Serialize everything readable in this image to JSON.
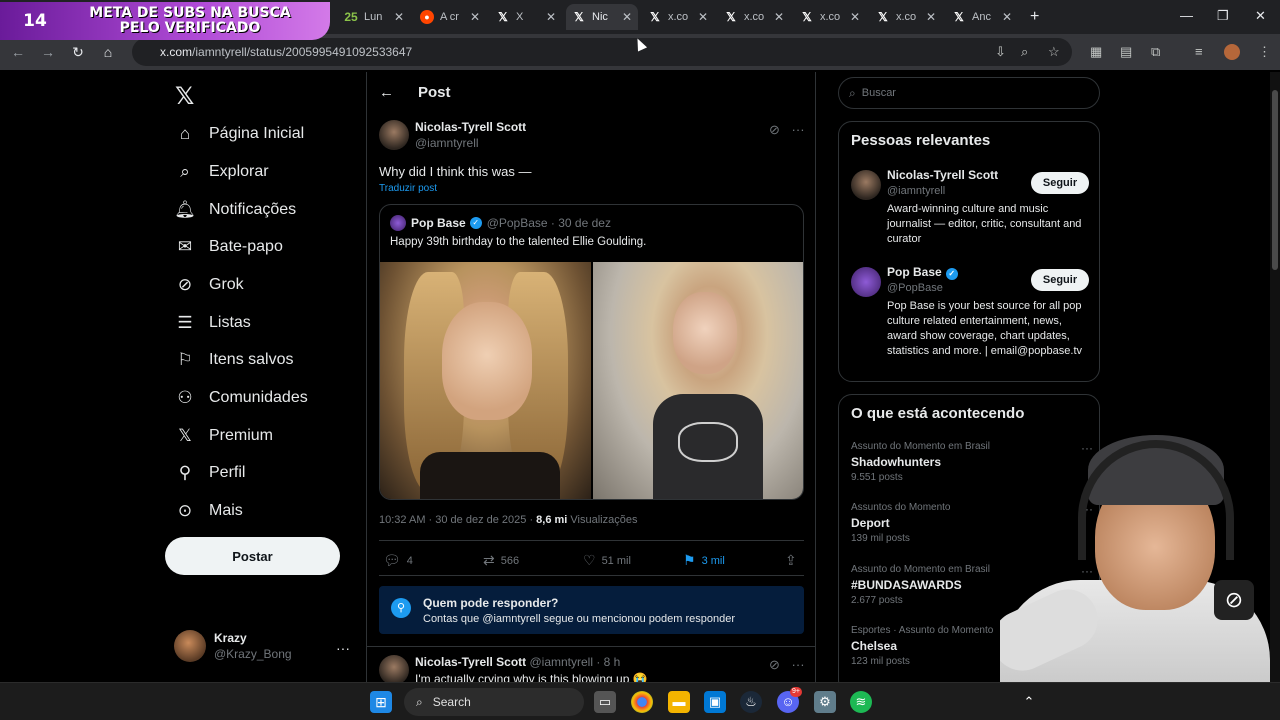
{
  "overlay": {
    "number": "14",
    "text": "META DE SUBS NA BUSCA PELO VERIFICADO",
    "number2": "25"
  },
  "tabs": [
    {
      "icon": "X",
      "label": "Lun"
    },
    {
      "icon": "R",
      "label": "A cr"
    },
    {
      "icon": "X",
      "label": "X"
    },
    {
      "icon": "X",
      "label": "Nic"
    },
    {
      "icon": "X",
      "label": "x.co"
    },
    {
      "icon": "X",
      "label": "x.co"
    },
    {
      "icon": "X",
      "label": "x.co"
    },
    {
      "icon": "X",
      "label": "x.co"
    },
    {
      "icon": "X",
      "label": "Anc"
    }
  ],
  "browser": {
    "url_host": "x.com",
    "url_path": "/iamntyrell/status/2005995491092533647"
  },
  "nav": {
    "items": [
      {
        "label": "Página Inicial"
      },
      {
        "label": "Explorar"
      },
      {
        "label": "Notificações"
      },
      {
        "label": "Bate-papo"
      },
      {
        "label": "Grok"
      },
      {
        "label": "Listas"
      },
      {
        "label": "Itens salvos"
      },
      {
        "label": "Comunidades"
      },
      {
        "label": "Premium"
      },
      {
        "label": "Perfil"
      },
      {
        "label": "Mais"
      }
    ],
    "post_button": "Postar",
    "user": {
      "name": "Krazy",
      "handle": "@Krazy_Bong"
    }
  },
  "post": {
    "header": "Post",
    "author_name": "Nicolas-Tyrell Scott",
    "author_handle": "@iamntyrell",
    "text": "Why did I think this was —",
    "translate": "Traduzir post",
    "quote": {
      "name": "Pop Base",
      "handle_date": "@PopBase · 30 de dez",
      "text": "Happy 39th birthday to the talented Ellie Goulding."
    },
    "timestamp": "10:32 AM · 30 de dez de 2025 · ",
    "views_count": "8,6 mi",
    "views_label": " Visualizações",
    "actions": {
      "replies": "4",
      "reposts": "566",
      "likes": "51 mil",
      "bookmarks": "3 mil"
    },
    "reply_restriction": {
      "title": "Quem pode responder?",
      "subtitle": "Contas que @iamntyrell segue ou mencionou podem responder"
    },
    "reply": {
      "name": "Nicolas-Tyrell Scott",
      "meta": " @iamntyrell · 8 h",
      "text": "I'm actually crying why is this blowing up 😭"
    }
  },
  "sidebar": {
    "search_placeholder": "Buscar",
    "relevant_title": "Pessoas relevantes",
    "people": [
      {
        "name": "Nicolas-Tyrell Scott",
        "handle": "@iamntyrell",
        "bio": "Award-winning culture and music journalist — editor, critic, consultant and curator",
        "follow": "Seguir"
      },
      {
        "name": "Pop Base",
        "handle": "@PopBase",
        "bio": "Pop Base is your best source for all pop culture related entertainment, news, award show coverage, chart updates, statistics and more. | email@popbase.tv",
        "follow": "Seguir"
      }
    ],
    "trending_title": "O que está acontecendo",
    "trends": [
      {
        "category": "Assunto do Momento em Brasil",
        "name": "Shadowhunters",
        "count": "9.551 posts"
      },
      {
        "category": "Assuntos do Momento",
        "name": "Deport",
        "count": "139 mil posts"
      },
      {
        "category": "Assunto do Momento em Brasil",
        "name": "#BUNDASAWARDS",
        "count": "2.677 posts"
      },
      {
        "category": "Esportes · Assunto do Momento",
        "name": "Chelsea",
        "count": "123 mil posts"
      }
    ]
  },
  "taskbar": {
    "search_label": "Search",
    "discord_badge": "9+"
  },
  "colors": {
    "accent": "#1d9bf0",
    "background": "#000000",
    "border": "#2f3336",
    "muted": "#71767b"
  }
}
